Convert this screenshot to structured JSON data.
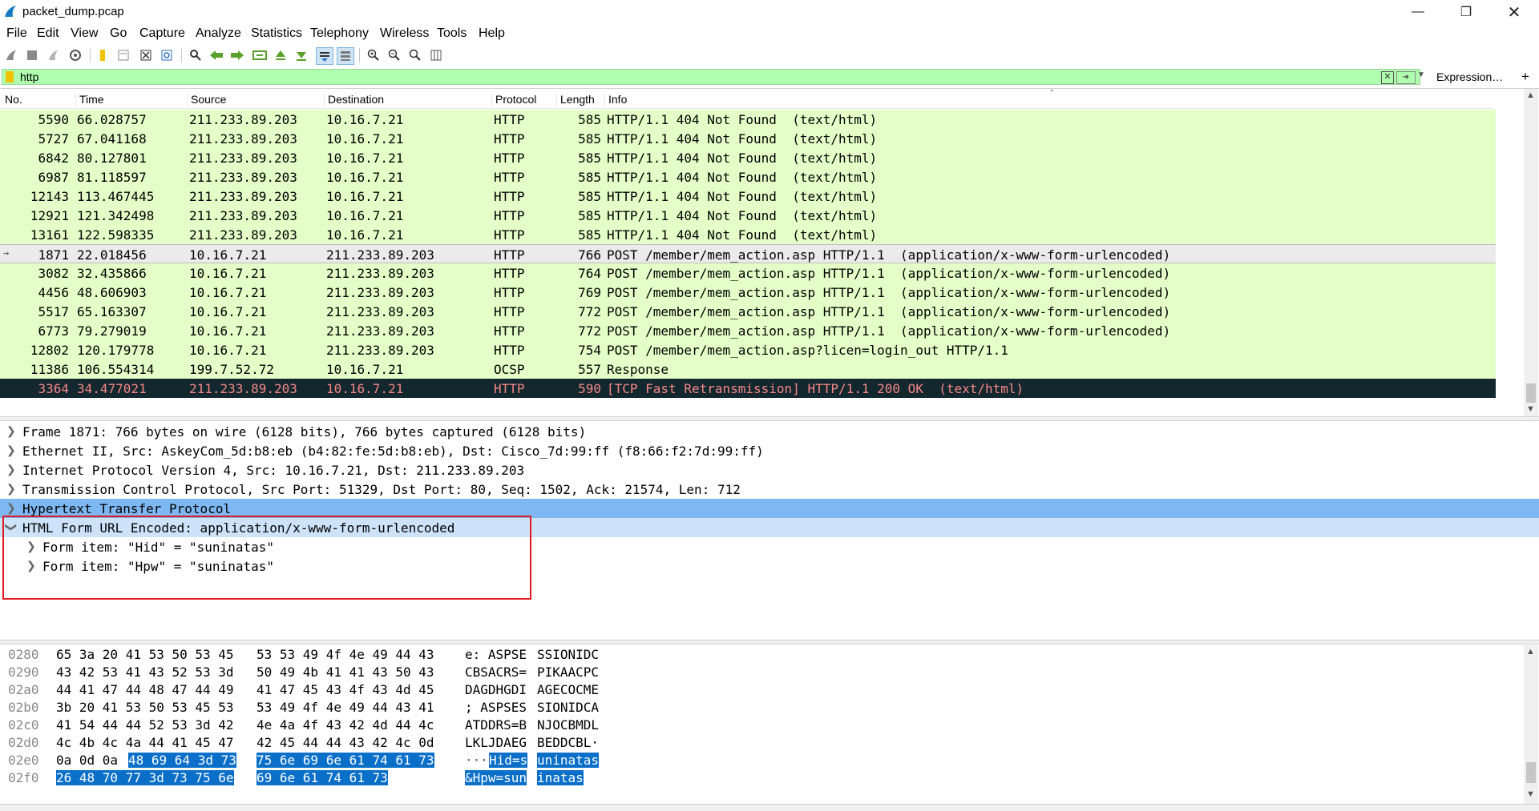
{
  "window": {
    "title": "packet_dump.pcap"
  },
  "menu": [
    "File",
    "Edit",
    "View",
    "Go",
    "Capture",
    "Analyze",
    "Statistics",
    "Telephony",
    "Wireless",
    "Tools",
    "Help"
  ],
  "filter": {
    "value": "http",
    "expression_label": "Expression…",
    "add_label": "+"
  },
  "columns": [
    "No.",
    "Time",
    "Source",
    "Destination",
    "Protocol",
    "Length",
    "Info"
  ],
  "packets": [
    {
      "no": "5590",
      "time": "66.028757",
      "src": "211.233.89.203",
      "dst": "10.16.7.21",
      "proto": "HTTP",
      "len": "585",
      "info": "HTTP/1.1 404 Not Found  (text/html)"
    },
    {
      "no": "5727",
      "time": "67.041168",
      "src": "211.233.89.203",
      "dst": "10.16.7.21",
      "proto": "HTTP",
      "len": "585",
      "info": "HTTP/1.1 404 Not Found  (text/html)"
    },
    {
      "no": "6842",
      "time": "80.127801",
      "src": "211.233.89.203",
      "dst": "10.16.7.21",
      "proto": "HTTP",
      "len": "585",
      "info": "HTTP/1.1 404 Not Found  (text/html)"
    },
    {
      "no": "6987",
      "time": "81.118597",
      "src": "211.233.89.203",
      "dst": "10.16.7.21",
      "proto": "HTTP",
      "len": "585",
      "info": "HTTP/1.1 404 Not Found  (text/html)"
    },
    {
      "no": "12143",
      "time": "113.467445",
      "src": "211.233.89.203",
      "dst": "10.16.7.21",
      "proto": "HTTP",
      "len": "585",
      "info": "HTTP/1.1 404 Not Found  (text/html)"
    },
    {
      "no": "12921",
      "time": "121.342498",
      "src": "211.233.89.203",
      "dst": "10.16.7.21",
      "proto": "HTTP",
      "len": "585",
      "info": "HTTP/1.1 404 Not Found  (text/html)"
    },
    {
      "no": "13161",
      "time": "122.598335",
      "src": "211.233.89.203",
      "dst": "10.16.7.21",
      "proto": "HTTP",
      "len": "585",
      "info": "HTTP/1.1 404 Not Found  (text/html)"
    },
    {
      "no": "1871",
      "time": "22.018456",
      "src": "10.16.7.21",
      "dst": "211.233.89.203",
      "proto": "HTTP",
      "len": "766",
      "info": "POST /member/mem_action.asp HTTP/1.1  (application/x-www-form-urlencoded)"
    },
    {
      "no": "3082",
      "time": "32.435866",
      "src": "10.16.7.21",
      "dst": "211.233.89.203",
      "proto": "HTTP",
      "len": "764",
      "info": "POST /member/mem_action.asp HTTP/1.1  (application/x-www-form-urlencoded)"
    },
    {
      "no": "4456",
      "time": "48.606903",
      "src": "10.16.7.21",
      "dst": "211.233.89.203",
      "proto": "HTTP",
      "len": "769",
      "info": "POST /member/mem_action.asp HTTP/1.1  (application/x-www-form-urlencoded)"
    },
    {
      "no": "5517",
      "time": "65.163307",
      "src": "10.16.7.21",
      "dst": "211.233.89.203",
      "proto": "HTTP",
      "len": "772",
      "info": "POST /member/mem_action.asp HTTP/1.1  (application/x-www-form-urlencoded)"
    },
    {
      "no": "6773",
      "time": "79.279019",
      "src": "10.16.7.21",
      "dst": "211.233.89.203",
      "proto": "HTTP",
      "len": "772",
      "info": "POST /member/mem_action.asp HTTP/1.1  (application/x-www-form-urlencoded)"
    },
    {
      "no": "12802",
      "time": "120.179778",
      "src": "10.16.7.21",
      "dst": "211.233.89.203",
      "proto": "HTTP",
      "len": "754",
      "info": "POST /member/mem_action.asp?licen=login_out HTTP/1.1"
    },
    {
      "no": "11386",
      "time": "106.554314",
      "src": "199.7.52.72",
      "dst": "10.16.7.21",
      "proto": "OCSP",
      "len": "557",
      "info": "Response"
    },
    {
      "no": "3364",
      "time": "34.477021",
      "src": "211.233.89.203",
      "dst": "10.16.7.21",
      "proto": "HTTP",
      "len": "590",
      "info": "[TCP Fast Retransmission] HTTP/1.1 200 OK  (text/html)"
    }
  ],
  "details": [
    "Frame 1871: 766 bytes on wire (6128 bits), 766 bytes captured (6128 bits)",
    "Ethernet II, Src: AskeyCom_5d:b8:eb (b4:82:fe:5d:b8:eb), Dst: Cisco_7d:99:ff (f8:66:f2:7d:99:ff)",
    "Internet Protocol Version 4, Src: 10.16.7.21, Dst: 211.233.89.203",
    "Transmission Control Protocol, Src Port: 51329, Dst Port: 80, Seq: 1502, Ack: 21574, Len: 712",
    "Hypertext Transfer Protocol",
    "HTML Form URL Encoded: application/x-www-form-urlencoded",
    "Form item: \"Hid\" = \"suninatas\"",
    "Form item: \"Hpw\" = \"suninatas\""
  ],
  "hex": {
    "rows": [
      {
        "off": "0280",
        "h1": "65 3a 20 41 53 50 53 45",
        "h2": "53 53 49 4f 4e 49 44 43",
        "a1": "e: ASPSE",
        "a2": "SSIONIDC"
      },
      {
        "off": "0290",
        "h1": "43 42 53 41 43 52 53 3d",
        "h2": "50 49 4b 41 41 43 50 43",
        "a1": "CBSACRS=",
        "a2": "PIKAACPC"
      },
      {
        "off": "02a0",
        "h1": "44 41 47 44 48 47 44 49",
        "h2": "41 47 45 43 4f 43 4d 45",
        "a1": "DAGDHGDI",
        "a2": "AGECOCME"
      },
      {
        "off": "02b0",
        "h1": "3b 20 41 53 50 53 45 53",
        "h2": "53 49 4f 4e 49 44 43 41",
        "a1": "; ASPSES",
        "a2": "SIONIDCA"
      },
      {
        "off": "02c0",
        "h1": "41 54 44 44 52 53 3d 42",
        "h2": "4e 4a 4f 43 42 4d 44 4c",
        "a1": "ATDDRS=B",
        "a2": "NJOCBMDL"
      },
      {
        "off": "02d0",
        "h1": "4c 4b 4c 4a 44 41 45 47",
        "h2": "42 45 44 44 43 42 4c 0d",
        "a1": "LKLJDAEG",
        "a2": "BEDDCBL·"
      }
    ],
    "row_e0": {
      "off": "02e0",
      "h1_plain": "0a 0d 0a ",
      "h1_sel": "48 69 64 3d 73",
      "h2": "75 6e 69 6e 61 74 61 73",
      "a1_plain": "···",
      "a1_sel": "Hid=s",
      "a2": "uninatas"
    },
    "row_f0": {
      "off": "02f0",
      "h1": "26 48 70 77 3d 73 75 6e",
      "h2": "69 6e 61 74 61 73",
      "a1": "&Hpw=sun",
      "a2": "inatas"
    }
  }
}
